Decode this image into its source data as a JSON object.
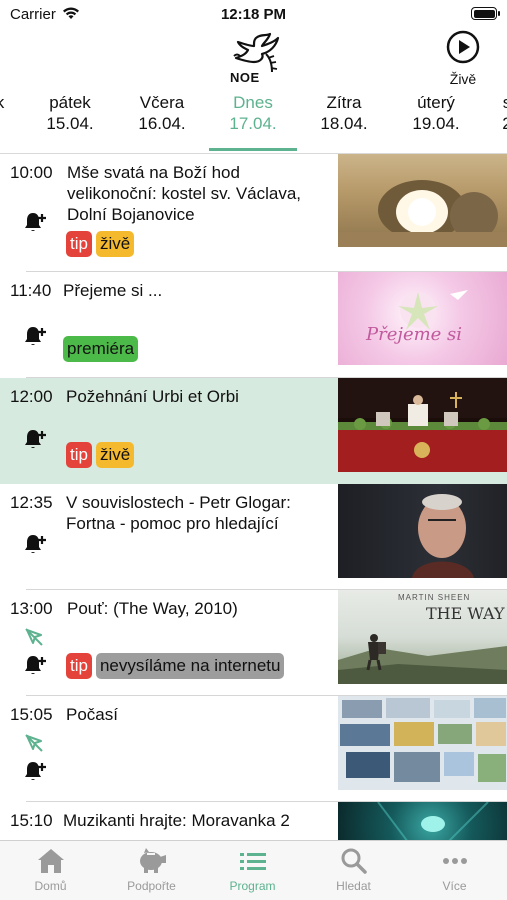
{
  "status_bar": {
    "carrier": "Carrier",
    "time": "12:18 PM"
  },
  "header": {
    "logo_text": "NOE",
    "live_label": "Živě"
  },
  "dates": [
    {
      "weekday": "k",
      "date": ""
    },
    {
      "weekday": "pátek",
      "date": "15.04."
    },
    {
      "weekday": "Včera",
      "date": "16.04."
    },
    {
      "weekday": "Dnes",
      "date": "17.04.",
      "active": true
    },
    {
      "weekday": "Zítra",
      "date": "18.04."
    },
    {
      "weekday": "úterý",
      "date": "19.04."
    },
    {
      "weekday": "s",
      "date": "2"
    }
  ],
  "programs": [
    {
      "time": "10:00",
      "title": "Mše svatá na Boží hod velikonoční: kostel sv. Václava, Dolní Bojanovice",
      "badges": [
        "tip",
        "živě"
      ]
    },
    {
      "time": "11:40",
      "title": "Přejeme si ...",
      "badges": [
        "premiéra"
      ],
      "thumb_text": "Přejeme si"
    },
    {
      "time": "12:00",
      "title": "Požehnání Urbi et Orbi",
      "badges": [
        "tip",
        "živě"
      ],
      "highlight": true
    },
    {
      "time": "12:35",
      "title": "V souvislostech - Petr Glogar: Fortna - pomoc pro hledající",
      "badges": []
    },
    {
      "time": "13:00",
      "title": "Pouť: (The Way, 2010)",
      "badges": [
        "tip",
        "nevysíláme na internetu"
      ],
      "thumb_text": "THE WAY",
      "thumb_sub": "MARTIN SHEEN"
    },
    {
      "time": "15:05",
      "title": "Počasí",
      "badges": []
    },
    {
      "time": "15:10",
      "title": "Muzikanti hrajte: Moravanka 2",
      "badges": []
    }
  ],
  "tabbar": [
    {
      "label": "Domů",
      "icon": "home-icon"
    },
    {
      "label": "Podpořte",
      "icon": "piggy-bank-icon"
    },
    {
      "label": "Program",
      "icon": "list-icon",
      "active": true
    },
    {
      "label": "Hledat",
      "icon": "search-icon"
    },
    {
      "label": "Více",
      "icon": "more-icon"
    }
  ],
  "colors": {
    "accent": "#5db28f",
    "tip": "#e3433a",
    "live": "#f5b92e",
    "premiere": "#4cba48",
    "not_online": "#9d9d9d",
    "highlight_row": "#d7eadf"
  }
}
